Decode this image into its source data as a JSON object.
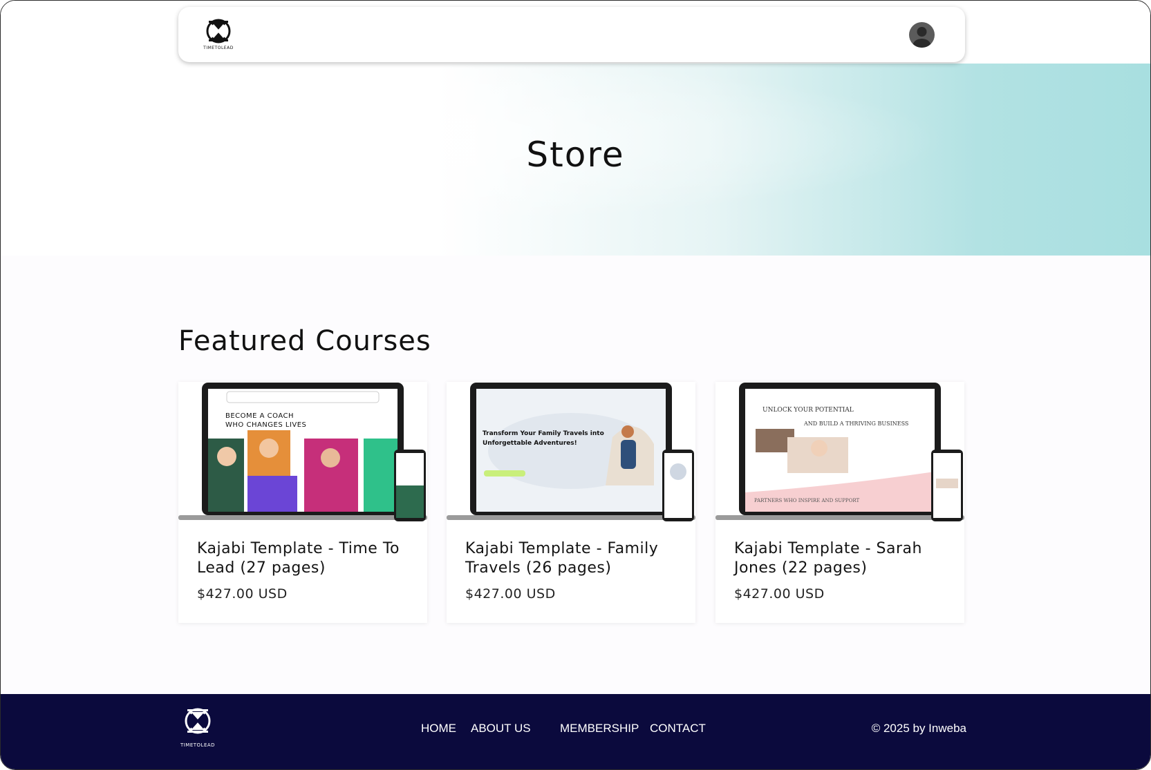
{
  "header": {
    "logo_text": "TIMETOLEAD",
    "avatar_icon": "user-avatar-icon"
  },
  "hero": {
    "title": "Store"
  },
  "featured": {
    "title": "Featured Courses",
    "courses": [
      {
        "name": "Kajabi Template - Time To Lead (27 pages)",
        "price": "$427.00 USD",
        "thumb": {
          "headline_1": "BECOME A COACH",
          "headline_2": "WHO CHANGES LIVES"
        }
      },
      {
        "name": "Kajabi Template - Family Travels (26 pages)",
        "price": "$427.00 USD",
        "thumb": {
          "headline_1": "Transform Your Family Travels into",
          "headline_2": "Unforgettable Adventures!"
        }
      },
      {
        "name": "Kajabi Template - Sarah Jones (22 pages)",
        "price": "$427.00 USD",
        "thumb": {
          "headline_1": "UNLOCK YOUR POTENTIAL",
          "headline_2": "AND BUILD A THRIVING BUSINESS",
          "footer_text": "PARTNERS WHO INSPIRE AND SUPPORT"
        }
      }
    ]
  },
  "footer": {
    "logo_text": "TIMETOLEAD",
    "nav": [
      "HOME",
      "ABOUT US",
      "MEMBERSHIP",
      "CONTACT"
    ],
    "copyright": "© 2025 by Inweba"
  },
  "colors": {
    "footer_bg": "#0b0a3d",
    "hero_accent": "#a8dfe0"
  }
}
